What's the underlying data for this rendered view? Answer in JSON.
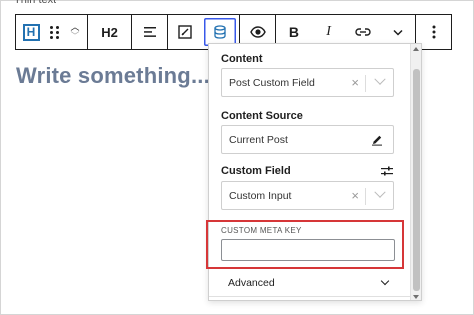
{
  "toolbar": {
    "block_type_letter": "H",
    "heading_level": "H2",
    "bold": "B",
    "italic": "I"
  },
  "editor": {
    "heading_text": "Write something..."
  },
  "panel": {
    "content": {
      "label": "Content",
      "value": "Post Custom Field"
    },
    "content_source": {
      "label": "Content Source",
      "value": "Current Post"
    },
    "custom_field": {
      "label": "Custom Field",
      "value": "Custom Input"
    },
    "custom_meta_key": {
      "label": "CUSTOM META KEY",
      "value": ""
    },
    "advanced": {
      "label": "Advanced"
    }
  },
  "colors": {
    "accent": "#3858e9",
    "highlight_border": "#d63638",
    "heading_placeholder": "#6b7b95"
  }
}
